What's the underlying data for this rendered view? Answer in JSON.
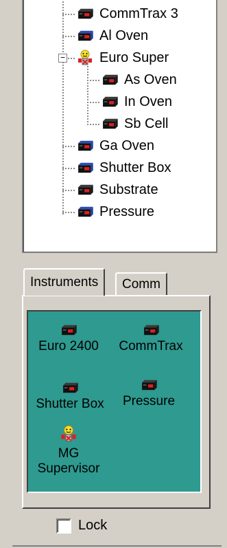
{
  "tree": {
    "nodes": [
      {
        "label": "CommTrax 3",
        "icon": "oven-device-icon"
      },
      {
        "label": "Al Oven",
        "icon": "oven-device-icon"
      },
      {
        "label": "Euro Super",
        "icon": "supervisor-robot-icon",
        "expander": "−"
      },
      {
        "label": "As Oven",
        "icon": "oven-device-icon"
      },
      {
        "label": "In Oven",
        "icon": "oven-device-icon"
      },
      {
        "label": "Sb Cell",
        "icon": "oven-device-icon"
      },
      {
        "label": "Ga Oven",
        "icon": "oven-device-icon"
      },
      {
        "label": "Shutter Box",
        "icon": "oven-device-icon"
      },
      {
        "label": "Substrate",
        "icon": "oven-device-icon"
      },
      {
        "label": "Pressure",
        "icon": "oven-device-icon"
      }
    ]
  },
  "tabs": [
    {
      "label": "Instruments",
      "active": true
    },
    {
      "label": "Comm",
      "active": false
    }
  ],
  "instruments": [
    {
      "label": "Euro 2400",
      "icon": "oven-device-icon"
    },
    {
      "label": "CommTrax",
      "icon": "oven-device-icon"
    },
    {
      "label": "Shutter Box",
      "icon": "oven-device-icon"
    },
    {
      "label": "Pressure",
      "icon": "oven-device-icon"
    },
    {
      "label_line1": "MG",
      "label_line2": "Supervisor",
      "icon": "supervisor-robot-icon"
    }
  ],
  "lock": {
    "label": "Lock",
    "checked": false
  },
  "colors": {
    "panel_bg": "#d4d0c8",
    "instrument_bg": "#2e9a90",
    "device_blue": "#1f3fa0",
    "device_red": "#e02020"
  }
}
